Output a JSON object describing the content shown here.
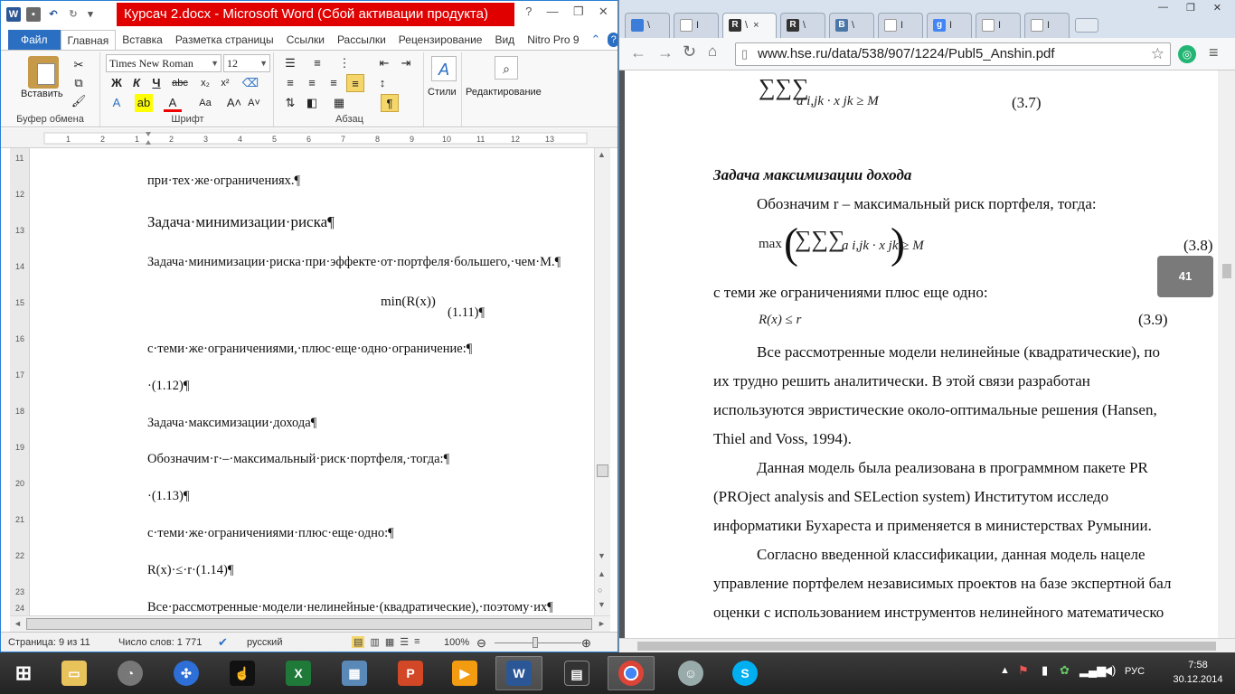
{
  "word": {
    "title": "Курсач 2.docx - Microsoft Word (Сбой активации продукта)",
    "tabs": [
      "Файл",
      "Главная",
      "Вставка",
      "Разметка страницы",
      "Ссылки",
      "Рассылки",
      "Рецензирование",
      "Вид",
      "Nitro Pro 9"
    ],
    "active_tab": "Главная",
    "ribbon": {
      "clipboard_label": "Буфер обмена",
      "paste_label": "Вставить",
      "font_label": "Шрифт",
      "font_name": "Times New Roman",
      "font_size": "12",
      "paragraph_label": "Абзац",
      "styles_label": "Стили",
      "editing_label": "Редактирование"
    },
    "document_lines": [
      "при·тех·же·ограничениях.¶",
      "Задача·минимизации·риска¶",
      "Задача·минимизации·риска·при·эффекте·от·портфеля·большего,·чем·M.¶",
      "(1.11)¶",
      "с·теми·же·ограничениями,·плюс·еще·одно·ограничение:¶",
      "·(1.12)¶",
      "Задача·максимизации·дохода¶",
      "Обозначим·r·–·максимальный·риск·портфеля,·тогда:¶",
      "·(1.13)¶",
      "с·теми·же·ограничениями·плюс·еще·одно:¶",
      "R(x)·≤·r·(1.14)¶",
      "Все·рассмотренные·модели·нелинейные·(квадратические),·поэтому·их¶"
    ],
    "formula_min": "min(R(x))",
    "status": {
      "page": "Страница: 9 из 11",
      "words": "Число слов: 1 771",
      "language": "русский",
      "zoom": "100%"
    }
  },
  "browser": {
    "tabs": [
      {
        "label": "\\",
        "color": "#3b7dd8"
      },
      {
        "label": "I",
        "color": "#ffffff"
      },
      {
        "label": "\\",
        "color": "#333333"
      },
      {
        "label": "\\",
        "color": "#333333"
      },
      {
        "label": "\\",
        "color": "#4a76a8"
      },
      {
        "label": "I",
        "color": "#ffffff"
      },
      {
        "label": "I",
        "color": "#4285f4"
      },
      {
        "label": "I",
        "color": "#ffffff"
      },
      {
        "label": "I",
        "color": "#ffffff"
      }
    ],
    "url": "www.hse.ru/data/538/907/1224/Publ5_Anshin.pdf",
    "pdf": {
      "eq37": "(3.7)",
      "eq37_tail": "a i,jk · x jk ≥ M",
      "heading": "Задача максимизации дохода",
      "line1": "Обозначим r – максимальный риск портфеля, тогда:",
      "eq38_max": "max",
      "eq38": "(3.8)",
      "line2": "с теми же ограничениями плюс еще одно:",
      "eq39_formula": "R(x) ≤ r",
      "eq39": "(3.9)",
      "para1": [
        "Все рассмотренные модели нелинейные (квадратические), по",
        "их трудно решить аналитически. В этой связи разработан",
        "используются эвристические около-оптимальные решения (Hansen,",
        "Thiel and Voss, 1994)."
      ],
      "para2": [
        "Данная модель была реализована в программном пакете PR",
        "(PROject analysis and SELection system) Институтом исследо",
        "информатики Бухареста и применяется в министерствах Румынии."
      ],
      "para3": [
        "Согласно введенной классификации, данная модель нацеле",
        "управление портфелем независимых проектов на базе экспертной бал",
        "оценки с использованием инструментов нелинейного математическо"
      ],
      "page_number": "41"
    }
  },
  "taskbar": {
    "language": "РУС",
    "time": "7:58",
    "date": "30.12.2014"
  }
}
